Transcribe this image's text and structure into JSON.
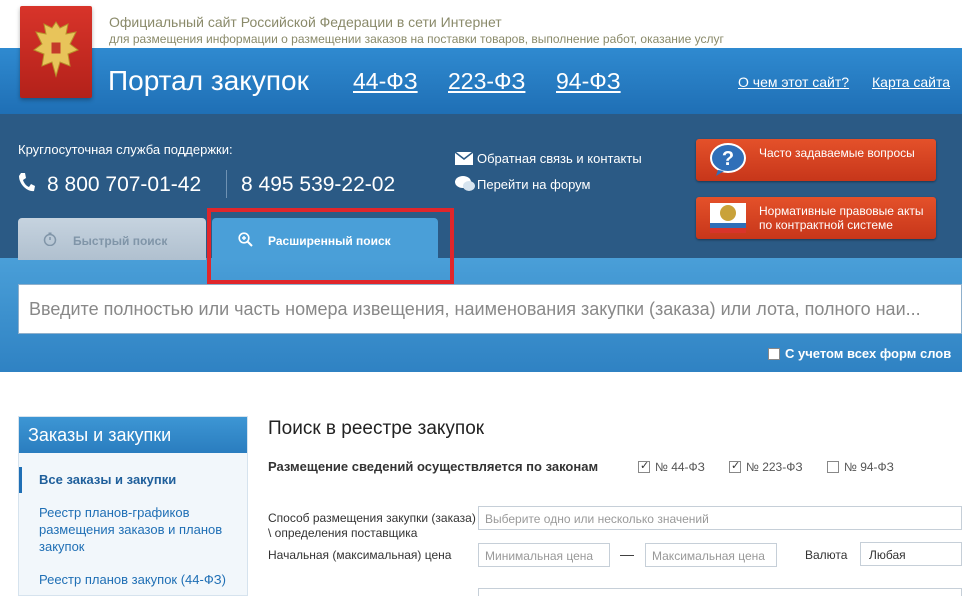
{
  "site": {
    "line1": "Официальный сайт Российской Федерации в сети Интернет",
    "line2": "для размещения информации о размещении заказов на поставки товаров, выполнение работ, оказание услуг"
  },
  "header": {
    "title": "Портал закупок",
    "laws": [
      "44-ФЗ",
      "223-ФЗ",
      "94-ФЗ"
    ],
    "about_link": "О чем этот сайт?",
    "sitemap_link": "Карта сайта"
  },
  "support": {
    "label": "Круглосуточная служба поддержки:",
    "phone1": "8 800 707-01-42",
    "phone2": "8 495 539-22-02",
    "feedback_link": "Обратная связь и контакты",
    "forum_link": "Перейти на форум"
  },
  "buttons": {
    "faq": "Часто задаваемые вопросы",
    "legal": "Нормативные правовые акты по контрактной системе"
  },
  "tabs": {
    "quick": "Быстрый поиск",
    "extended": "Расширенный поиск"
  },
  "search": {
    "placeholder": "Введите полностью или часть номера извещения, наименования закупки (заказа) или лота, полного наи...",
    "all_forms_label": "С учетом всех форм слов",
    "all_forms_checked": false
  },
  "sidebar": {
    "title": "Заказы и закупки",
    "items": [
      {
        "label": "Все заказы и закупки",
        "active": true
      },
      {
        "label": "Реестр планов-графиков размещения заказов и планов закупок",
        "active": false
      },
      {
        "label": "Реестр планов закупок (44-ФЗ)",
        "active": false
      }
    ]
  },
  "main": {
    "title": "Поиск в реестре закупок",
    "law_row_label": "Размещение сведений осуществляется по законам",
    "law_checks": [
      {
        "label": "№ 44-ФЗ",
        "checked": true
      },
      {
        "label": "№ 223-ФЗ",
        "checked": true
      },
      {
        "label": "№ 94-ФЗ",
        "checked": false
      }
    ],
    "method_label": "Способ размещения закупки (заказа) \\ определения поставщика",
    "method_placeholder": "Выберите одно или несколько значений",
    "price_label": "Начальная (максимальная) цена",
    "min_price_placeholder": "Минимальная цена",
    "max_price_placeholder": "Максимальная цена",
    "price_dash": "—",
    "currency_label": "Валюта",
    "currency_value": "Любая"
  },
  "colors": {
    "header_blue": "#2f8ad0",
    "info_band": "#2b5a85",
    "accent_red": "#e0262b",
    "link_blue": "#1f6fb5"
  }
}
